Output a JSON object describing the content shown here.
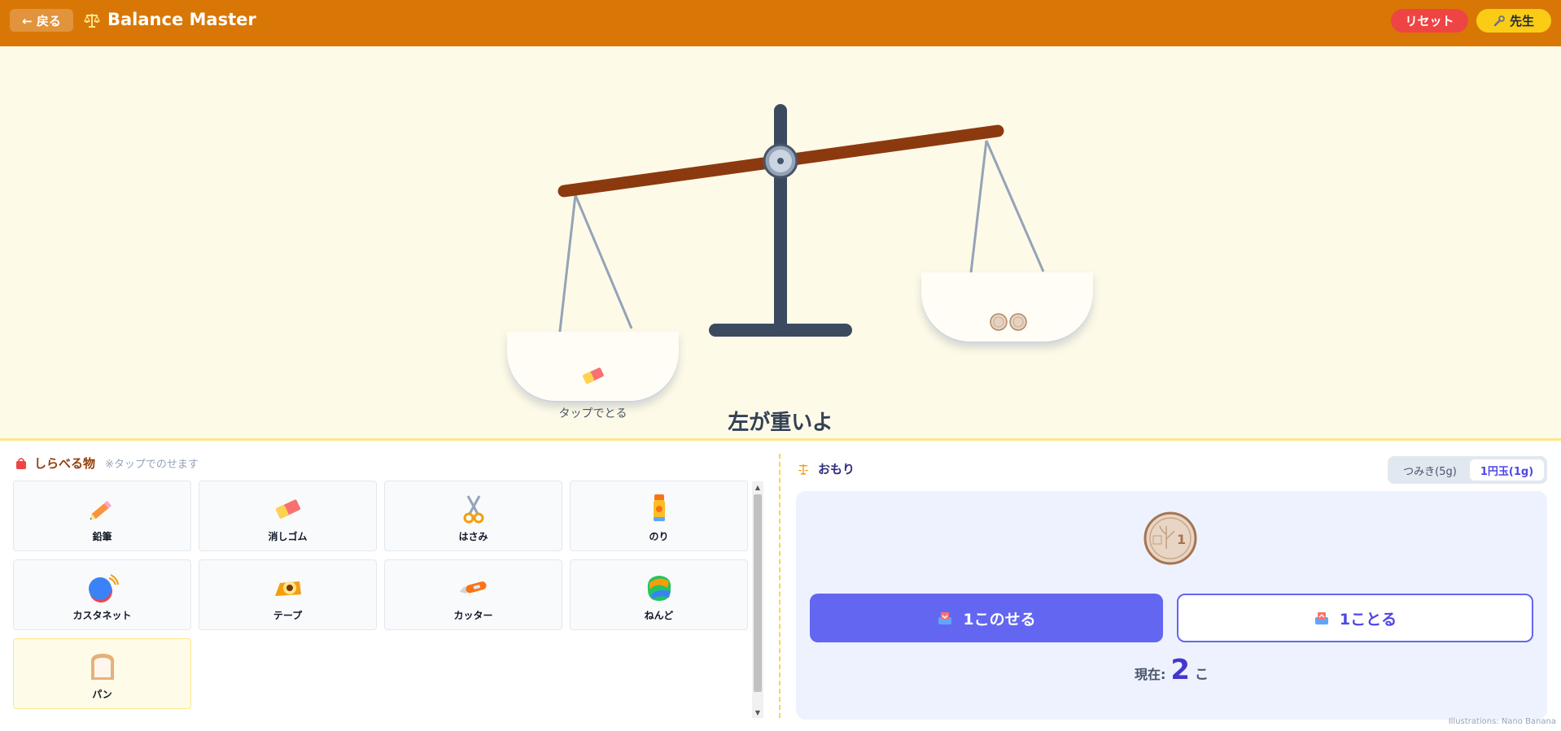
{
  "header": {
    "back_label": "← 戻る",
    "title": "Balance Master",
    "reset_label": "リセット",
    "teacher_label": "先生"
  },
  "scale": {
    "left_hint": "タップでとる",
    "status": "左が重いよ",
    "left_pan_item": "eraser-icon",
    "right_pan_count": 2
  },
  "items": {
    "title": "しらべる物",
    "subtitle": "※タップでのせます",
    "list": [
      {
        "label": "鉛筆",
        "icon": "pencil-icon"
      },
      {
        "label": "消しゴム",
        "icon": "eraser-icon"
      },
      {
        "label": "はさみ",
        "icon": "scissors-icon"
      },
      {
        "label": "のり",
        "icon": "glue-icon"
      },
      {
        "label": "カスタネット",
        "icon": "castanet-icon"
      },
      {
        "label": "テープ",
        "icon": "tape-icon"
      },
      {
        "label": "カッター",
        "icon": "cutter-icon"
      },
      {
        "label": "ねんど",
        "icon": "clay-icon"
      },
      {
        "label": "パン",
        "icon": "bread-icon"
      }
    ]
  },
  "weights": {
    "title": "おもり",
    "tabs": [
      "つみき(5g)",
      "1円玉(1g)"
    ],
    "selected_tab": "1円玉(1g)",
    "add_label": "1このせる",
    "remove_label": "1ことる",
    "count_label": "現在:",
    "count_value": "2",
    "count_unit": "こ"
  },
  "credit": "Illustrations: Nano Banana",
  "colors": {
    "header": "#d97706",
    "reset": "#ef4444",
    "teacher": "#facc15",
    "primary": "#6366f1",
    "beam": "#8b3a0f",
    "post": "#3b4a5e"
  }
}
